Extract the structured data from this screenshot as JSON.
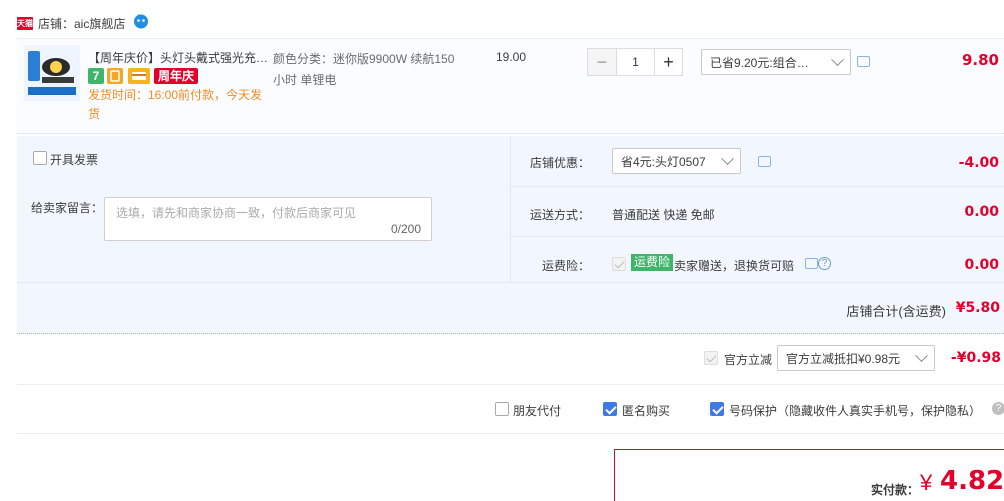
{
  "shop": {
    "logo_text": "天猫",
    "label": "店铺：aic旗舰店"
  },
  "item": {
    "title": "【周年庆价】头灯头戴式强光充…",
    "badge_seven": "7",
    "badge_anniversary": "周年庆",
    "ship_time": "发货时间：16:00前付款，今天发货",
    "sku": "颜色分类：迷你版9900W 续航150小时 单锂电",
    "price": "19.00",
    "quantity": "1",
    "qty_minus": "−",
    "qty_plus": "+",
    "combo_selected": "已省9.20元:组合…",
    "subtotal": "9.80"
  },
  "options": {
    "invoice_label": "开具发票",
    "message_label": "给卖家留言：",
    "message_placeholder": "选填，请先和商家协商一致，付款后商家可见",
    "message_count": "0/200",
    "shop_coupon_label": "店铺优惠：",
    "shop_coupon_selected": "省4元:头灯0507",
    "shop_coupon_amount": "-4.00",
    "shipping_label": "运送方式：",
    "shipping_value": "普通配送 快递 免邮",
    "shipping_amount": "0.00",
    "insurance_label": "运费险：",
    "insurance_tag": "运费险",
    "insurance_text": "卖家赠送，退换货可赔",
    "insurance_amount": "0.00",
    "shop_total_label": "店铺合计(含运费)",
    "shop_total_value": "¥5.80"
  },
  "official": {
    "label": "官方立减",
    "selected": "官方立减抵扣¥0.98元",
    "amount": "-¥0.98"
  },
  "flags": {
    "friend_pay": "朋友代付",
    "anonymous": "匿名购买",
    "number_protect": "号码保护（隐藏收件人真实手机号，保护隐私）"
  },
  "payment": {
    "label": "实付款：",
    "currency": "¥",
    "amount": "4.82"
  },
  "colors": {
    "accent_red": "#e4002b",
    "link_blue": "#3e79e6",
    "ship_orange": "#f58b22",
    "insurance_green": "#3fb56a"
  }
}
